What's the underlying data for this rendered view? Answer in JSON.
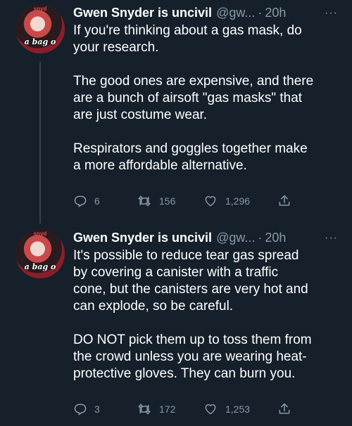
{
  "tweets": [
    {
      "author_name": "Gwen Snyder is uncivil",
      "handle": "@gw...",
      "dot": "·",
      "time": "20h",
      "more": "···",
      "avatar": {
        "caption": "a bag o",
        "top": "snyd"
      },
      "text": "If you're thinking about a gas mask, do\nyour research.\n\nThe good ones are expensive, and there\nare a bunch of airsoft \"gas masks\" that\nare just costume wear.\n\nRespirators and goggles together make\na more affordable alternative.",
      "reply_count": "6",
      "retweet_count": "156",
      "like_count": "1,296"
    },
    {
      "author_name": "Gwen Snyder is uncivil",
      "handle": "@gw...",
      "dot": "·",
      "time": "20h",
      "more": "···",
      "avatar": {
        "caption": "a bag o",
        "top": "snyd"
      },
      "text": "It's possible to reduce tear gas spread\nby covering a canister with a traffic\ncone, but the canisters are very hot and\ncan explode, so be careful.\n\nDO NOT pick them up to toss them from\nthe crowd unless you are wearing heat-\nprotective gloves. They can burn you.",
      "reply_count": "3",
      "retweet_count": "172",
      "like_count": "1,253"
    }
  ]
}
